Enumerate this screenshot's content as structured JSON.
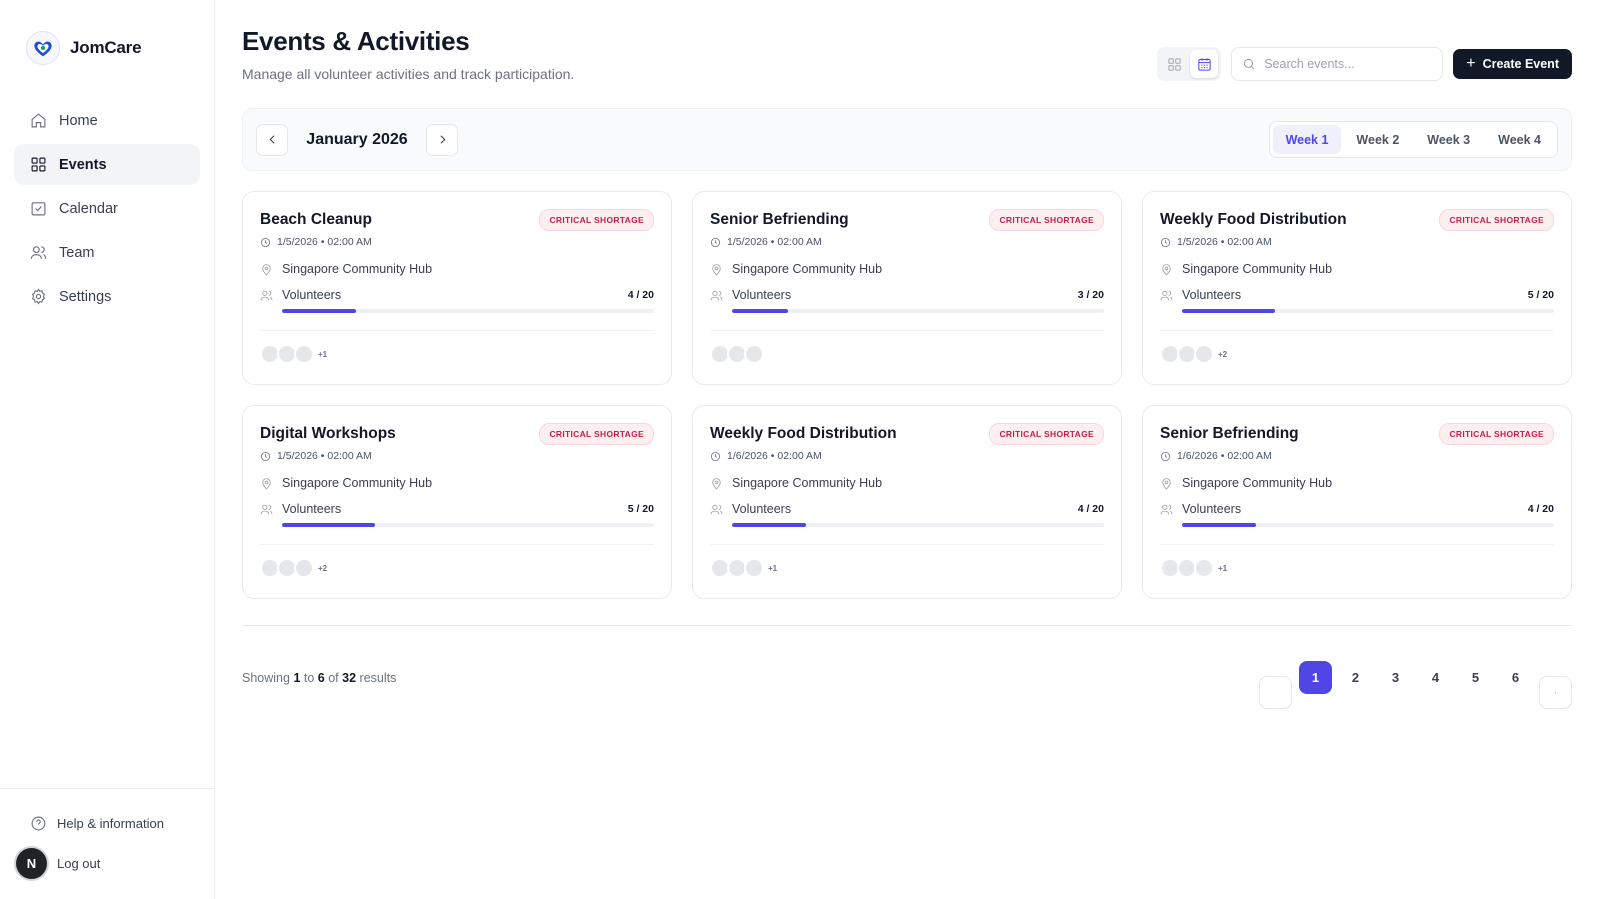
{
  "brand": {
    "name": "JomCare"
  },
  "sidebar": {
    "items": [
      {
        "label": "Home",
        "icon": "home-icon"
      },
      {
        "label": "Events",
        "icon": "grid-icon",
        "active": true
      },
      {
        "label": "Calendar",
        "icon": "calendar-check-icon"
      },
      {
        "label": "Team",
        "icon": "users-icon"
      },
      {
        "label": "Settings",
        "icon": "gear-icon"
      }
    ],
    "help_label": "Help & information",
    "logout_label": "Log out",
    "avatar_initial": "N"
  },
  "header": {
    "title": "Events & Activities",
    "subtitle": "Manage all volunteer activities and track participation.",
    "search_placeholder": "Search events...",
    "create_label": "Create Event"
  },
  "toolbar": {
    "month": "January 2026",
    "weeks": [
      "Week 1",
      "Week 2",
      "Week 3",
      "Week 4"
    ],
    "active_week": 0
  },
  "events": [
    {
      "title": "Beach Cleanup",
      "badge": "CRITICAL SHORTAGE",
      "datetime": "1/5/2026 • 02:00 AM",
      "location": "Singapore Community Hub",
      "volunteers_label": "Volunteers",
      "count": "4 / 20",
      "filled": 4,
      "capacity": 20,
      "avatars": 3,
      "more": "+1"
    },
    {
      "title": "Senior Befriending",
      "badge": "CRITICAL SHORTAGE",
      "datetime": "1/5/2026 • 02:00 AM",
      "location": "Singapore Community Hub",
      "volunteers_label": "Volunteers",
      "count": "3 / 20",
      "filled": 3,
      "capacity": 20,
      "avatars": 3,
      "more": ""
    },
    {
      "title": "Weekly Food Distribution",
      "badge": "CRITICAL SHORTAGE",
      "datetime": "1/5/2026 • 02:00 AM",
      "location": "Singapore Community Hub",
      "volunteers_label": "Volunteers",
      "count": "5 / 20",
      "filled": 5,
      "capacity": 20,
      "avatars": 3,
      "more": "+2"
    },
    {
      "title": "Digital Workshops",
      "badge": "CRITICAL SHORTAGE",
      "datetime": "1/5/2026 • 02:00 AM",
      "location": "Singapore Community Hub",
      "volunteers_label": "Volunteers",
      "count": "5 / 20",
      "filled": 5,
      "capacity": 20,
      "avatars": 3,
      "more": "+2"
    },
    {
      "title": "Weekly Food Distribution",
      "badge": "CRITICAL SHORTAGE",
      "datetime": "1/6/2026 • 02:00 AM",
      "location": "Singapore Community Hub",
      "volunteers_label": "Volunteers",
      "count": "4 / 20",
      "filled": 4,
      "capacity": 20,
      "avatars": 3,
      "more": "+1"
    },
    {
      "title": "Senior Befriending",
      "badge": "CRITICAL SHORTAGE",
      "datetime": "1/6/2026 • 02:00 AM",
      "location": "Singapore Community Hub",
      "volunteers_label": "Volunteers",
      "count": "4 / 20",
      "filled": 4,
      "capacity": 20,
      "avatars": 3,
      "more": "+1"
    }
  ],
  "pagination": {
    "showing_prefix": "Showing",
    "from": "1",
    "to_word": "to",
    "to": "6",
    "of_word": "of",
    "total": "32",
    "suffix": "results",
    "pages": [
      "1",
      "2",
      "3",
      "4",
      "5",
      "6"
    ],
    "active_page": 0
  },
  "colors": {
    "accent": "#4f46e5",
    "badge_text": "#c81e4a",
    "badge_bg": "#fdeef0",
    "primary_button": "#111827"
  }
}
